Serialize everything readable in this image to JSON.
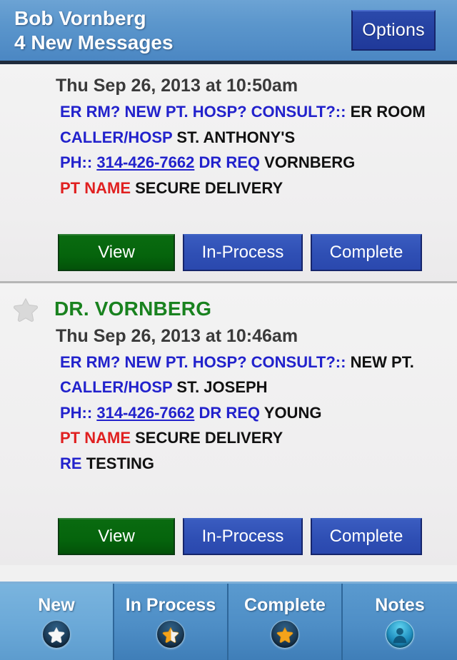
{
  "header": {
    "user_name": "Bob Vornberg",
    "subtitle": "4 New Messages",
    "options_label": "Options"
  },
  "colors": {
    "header_blue": "#4b87c3",
    "label_blue": "#2222cc",
    "alert_red": "#e02020",
    "sender_green": "#19821f",
    "view_button_green": "#05640c",
    "action_button_blue": "#2f4fb4",
    "tabbar_blue": "#4e8ec6",
    "tab_active_blue": "#6ba9d8",
    "body_background": "#f1f1f1"
  },
  "messages": [
    {
      "star_icon": "star-icon",
      "star_state": "none",
      "sender": "",
      "date": "Thu Sep 26, 2013 at 10:50am",
      "fields": [
        {
          "label": "ER RM? NEW PT. HOSP? CONSULT?::",
          "label_color": "blue",
          "value": "ER ROOM"
        },
        {
          "label": "CALLER/HOSP",
          "label_color": "blue",
          "value": "ST. ANTHONY'S"
        },
        {
          "label": "PH::",
          "label_color": "blue",
          "link": "314-426-7662",
          "mid_label": "DR REQ",
          "value": "VORNBERG"
        },
        {
          "label": "PT NAME",
          "label_color": "red",
          "value": "SECURE DELIVERY"
        }
      ],
      "actions": [
        {
          "label": "View",
          "style": "view"
        },
        {
          "label": "In-Process",
          "style": "blue"
        },
        {
          "label": "Complete",
          "style": "blue"
        }
      ]
    },
    {
      "star_icon": "star-icon",
      "star_state": "gray",
      "sender": "DR. VORNBERG",
      "date": "Thu Sep 26, 2013 at 10:46am",
      "fields": [
        {
          "label": "ER RM? NEW PT. HOSP? CONSULT?::",
          "label_color": "blue",
          "value": "NEW PT."
        },
        {
          "label": "CALLER/HOSP",
          "label_color": "blue",
          "value": "ST. JOSEPH"
        },
        {
          "label": "PH::",
          "label_color": "blue",
          "link": "314-426-7662",
          "mid_label": "DR REQ",
          "value": "YOUNG"
        },
        {
          "label": "PT NAME",
          "label_color": "red",
          "value": "SECURE DELIVERY"
        },
        {
          "label": "RE",
          "label_color": "blue",
          "value": "TESTING"
        }
      ],
      "actions": [
        {
          "label": "View",
          "style": "view"
        },
        {
          "label": "In-Process",
          "style": "blue"
        },
        {
          "label": "Complete",
          "style": "blue"
        }
      ]
    }
  ],
  "tabbar": {
    "tabs": [
      {
        "label": "New",
        "icon": "white-star-icon",
        "active": true
      },
      {
        "label": "In Process",
        "icon": "half-orange-star-icon",
        "active": false
      },
      {
        "label": "Complete",
        "icon": "orange-star-icon",
        "active": false
      },
      {
        "label": "Notes",
        "icon": "person-icon",
        "active": false
      }
    ]
  }
}
